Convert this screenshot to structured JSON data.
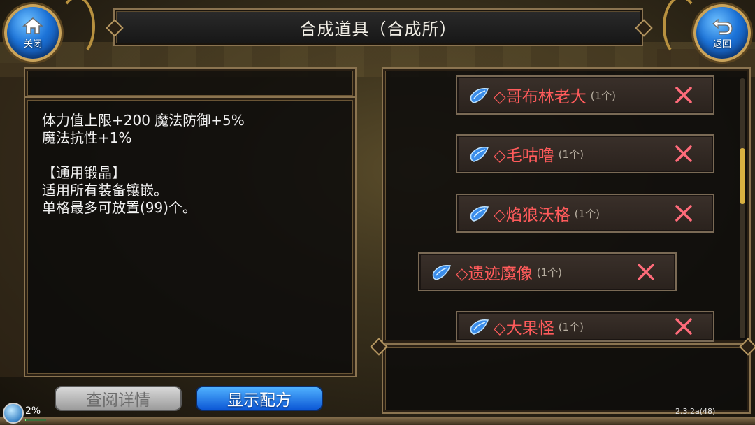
{
  "window": {
    "title": "合成道具（合成所）"
  },
  "nav": {
    "close_label": "关闭",
    "back_label": "返回"
  },
  "description": {
    "text": "体力值上限+200 魔法防御+5%\n魔法抗性+1%\n\n【通用锻晶】\n适用所有装备镶嵌。\n单格最多可放置(99)个。"
  },
  "items": [
    {
      "name": "◇哥布林老大",
      "qty": "(1个)"
    },
    {
      "name": "◇毛咕噜",
      "qty": "(1个)"
    },
    {
      "name": "◇焰狼沃格",
      "qty": "(1个)"
    },
    {
      "name": "◇遗迹魔像",
      "qty": "(1个)"
    },
    {
      "name": "◇大果怪",
      "qty": "(1个)"
    }
  ],
  "buttons": {
    "details": "查阅详情",
    "show_recipe": "显示配方"
  },
  "status": {
    "percent": "2%",
    "progress_fraction": 0.02,
    "version": "2.3.2a(48)"
  },
  "colors": {
    "item_name": "#ff5b5b",
    "remove_x": "#ff6b7a",
    "accent_blue": "#1c73d8",
    "frame_gold": "#8b7450"
  },
  "icons": {
    "close": "home-icon",
    "back": "return-arrow-icon",
    "item": "blue-crystal-icon",
    "remove": "close-x-icon"
  }
}
